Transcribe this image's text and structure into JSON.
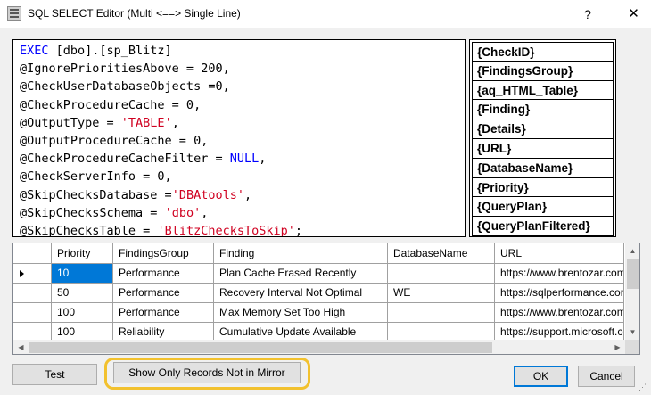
{
  "window": {
    "title": "SQL SELECT Editor (Multi <==> Single Line)",
    "help_label": "?",
    "close_label": "✕"
  },
  "editor": {
    "lines": [
      [
        {
          "t": "EXEC",
          "c": "kw"
        },
        {
          "t": " [dbo].[sp_Blitz]",
          "c": ""
        }
      ],
      [
        {
          "t": "@IgnorePrioritiesAbove = 200,",
          "c": ""
        }
      ],
      [
        {
          "t": "@CheckUserDatabaseObjects =0,",
          "c": ""
        }
      ],
      [
        {
          "t": "@CheckProcedureCache = 0,",
          "c": ""
        }
      ],
      [
        {
          "t": "@OutputType = ",
          "c": ""
        },
        {
          "t": "'TABLE'",
          "c": "str"
        },
        {
          "t": ",",
          "c": ""
        }
      ],
      [
        {
          "t": "@OutputProcedureCache = 0,",
          "c": ""
        }
      ],
      [
        {
          "t": "@CheckProcedureCacheFilter = ",
          "c": ""
        },
        {
          "t": "NULL",
          "c": "kw"
        },
        {
          "t": ",",
          "c": ""
        }
      ],
      [
        {
          "t": "@CheckServerInfo = 0,",
          "c": ""
        }
      ],
      [
        {
          "t": "@SkipChecksDatabase =",
          "c": ""
        },
        {
          "t": "'DBAtools'",
          "c": "str"
        },
        {
          "t": ",",
          "c": ""
        }
      ],
      [
        {
          "t": "@SkipChecksSchema = ",
          "c": ""
        },
        {
          "t": "'dbo'",
          "c": "str"
        },
        {
          "t": ",",
          "c": ""
        }
      ],
      [
        {
          "t": "@SkipChecksTable = ",
          "c": ""
        },
        {
          "t": "'BlitzChecksToSkip'",
          "c": "str"
        },
        {
          "t": ";",
          "c": ""
        }
      ]
    ]
  },
  "columns_list": [
    "{CheckID}",
    "{FindingsGroup}",
    "{aq_HTML_Table}",
    "{Finding}",
    "{Details}",
    "{URL}",
    "{DatabaseName}",
    "{Priority}",
    "{QueryPlan}",
    "{QueryPlanFiltered}"
  ],
  "grid": {
    "headers": [
      "Priority",
      "FindingsGroup",
      "Finding",
      "DatabaseName",
      "URL"
    ],
    "rows": [
      [
        "10",
        "Performance",
        "Plan Cache Erased Recently",
        "",
        "https://www.brentozar.com"
      ],
      [
        "50",
        "Performance",
        "Recovery Interval Not Optimal",
        "WE",
        "https://sqlperformance.com"
      ],
      [
        "100",
        "Performance",
        "Max Memory Set Too High",
        "",
        "https://www.brentozar.com"
      ],
      [
        "100",
        "Reliability",
        "Cumulative Update Available",
        "",
        "https://support.microsoft.com"
      ]
    ],
    "selected_row": 0
  },
  "buttons": {
    "test": "Test",
    "mirror": "Show Only Records Not in Mirror",
    "ok": "OK",
    "cancel": "Cancel"
  },
  "colors": {
    "keyword": "#0000ff",
    "string": "#d00020",
    "selection": "#0078d7",
    "highlight_ring": "#f2c12e"
  }
}
